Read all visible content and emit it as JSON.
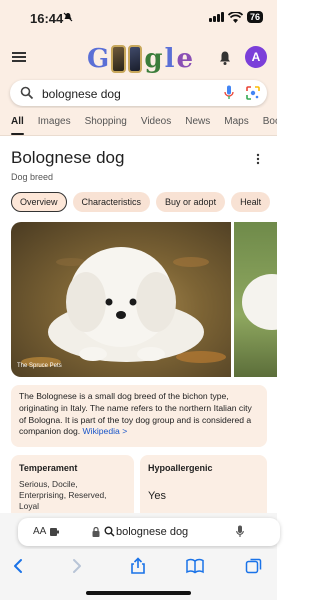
{
  "status": {
    "time": "16:44",
    "battery": "76"
  },
  "header": {
    "avatar_letter": "A"
  },
  "search": {
    "query": "bolognese dog"
  },
  "tabs": [
    "All",
    "Images",
    "Shopping",
    "Videos",
    "News",
    "Maps",
    "Book"
  ],
  "panel": {
    "title": "Bolognese dog",
    "subtitle": "Dog breed",
    "chips": [
      "Overview",
      "Characteristics",
      "Buy or adopt",
      "Healt"
    ],
    "image_credit": "The Spruce Pets",
    "description": "The Bolognese is a small dog breed of the bichon type, originating in Italy. The name refers to the northern Italian city of Bologna. It is part of the toy dog group and is considered a companion dog.",
    "source_link": "Wikipedia >",
    "cards": [
      {
        "heading": "Temperament",
        "value": "Serious, Docile, Enterprising, Reserved, Loyal"
      },
      {
        "heading": "Hypoallergenic",
        "value": "Yes"
      }
    ]
  },
  "safari": {
    "aa": "AA",
    "url_text": "bolognese dog"
  },
  "colors": {
    "accent_blue": "#1a56c9",
    "avatar": "#7b3fd9",
    "panel_bg": "#fbeee4"
  }
}
